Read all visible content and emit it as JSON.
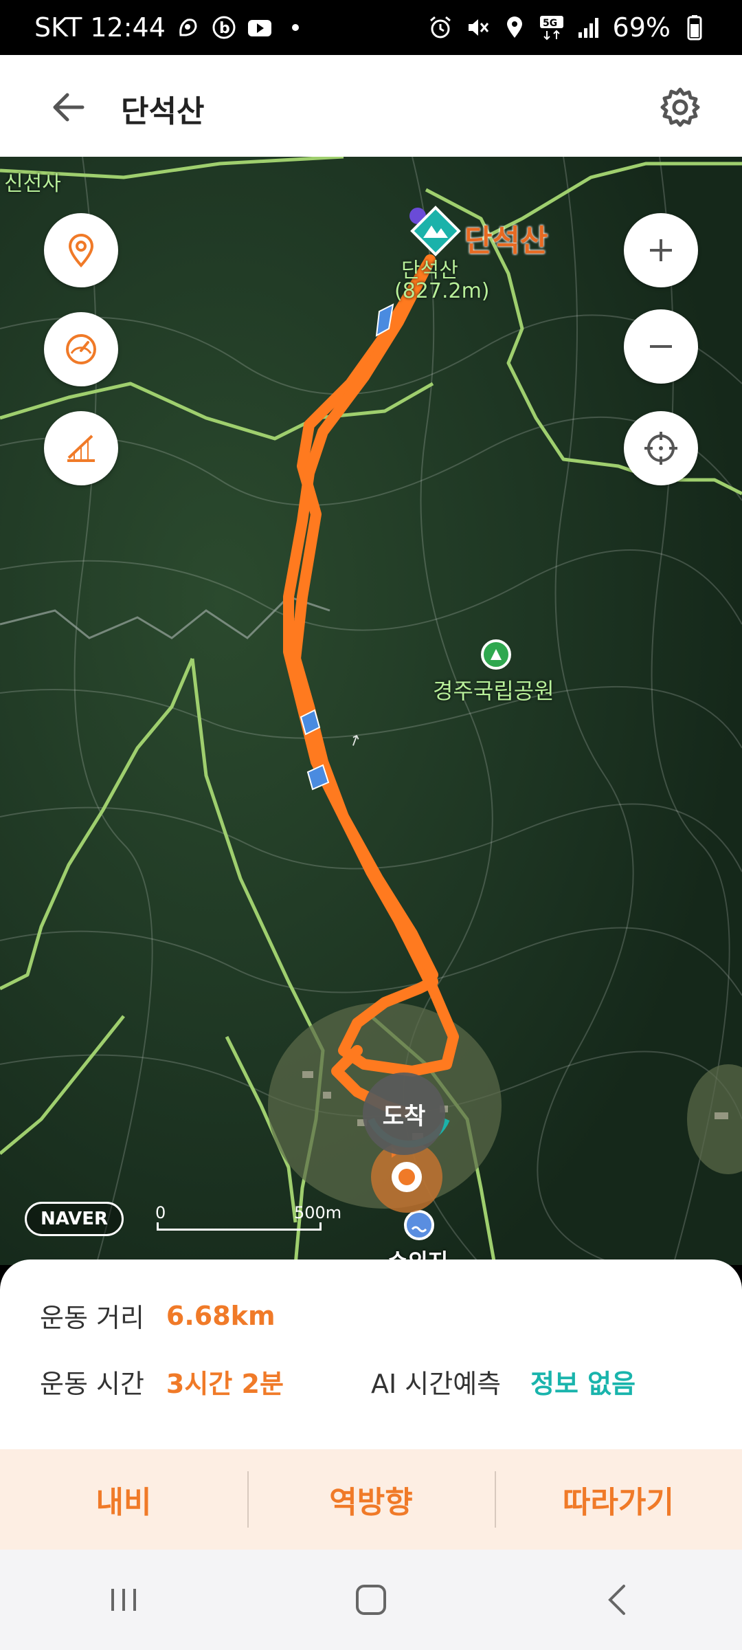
{
  "status_bar": {
    "carrier_time": "SKT 12:44",
    "network": "5G",
    "battery": "69%",
    "left_icons": [
      "activity-icon",
      "b-app-icon",
      "youtube-icon",
      "dot-icon"
    ],
    "right_icons": [
      "alarm-icon",
      "mute-icon",
      "location-icon",
      "network-icon",
      "signal-icon",
      "battery-icon"
    ]
  },
  "app_bar": {
    "title": "단석산",
    "back_icon": "arrow-left-icon",
    "settings_icon": "gear-icon"
  },
  "map": {
    "peak_name": "단석산",
    "peak_sub_name": "단석산",
    "peak_sub_elev": "(827.2m)",
    "park_label": "경주국립공원",
    "corner_label": "신선사",
    "reservoir_label": "수의지",
    "arrival_label": "도착",
    "provider": "NAVER",
    "scale_zero": "0",
    "scale_max": "500m",
    "left_buttons": [
      "location-pin-icon",
      "speed-gauge-icon",
      "elevation-profile-icon"
    ],
    "right_buttons": [
      "zoom-in-icon",
      "zoom-out-icon",
      "crosshair-icon"
    ],
    "route_color": "#ff7a1f"
  },
  "stats": {
    "distance_label": "운동 거리",
    "distance_value": "6.68km",
    "time_label": "운동 시간",
    "time_value": "3시간 2분",
    "ai_label": "AI 시간예측",
    "ai_value": "정보 없음"
  },
  "actions": [
    "내비",
    "역방향",
    "따라가기"
  ],
  "nav_bar": [
    "recent-apps-icon",
    "home-icon",
    "back-icon"
  ],
  "colors": {
    "accent": "#f07a28",
    "teal": "#19b4ac",
    "action_bg": "#fdeee3"
  }
}
